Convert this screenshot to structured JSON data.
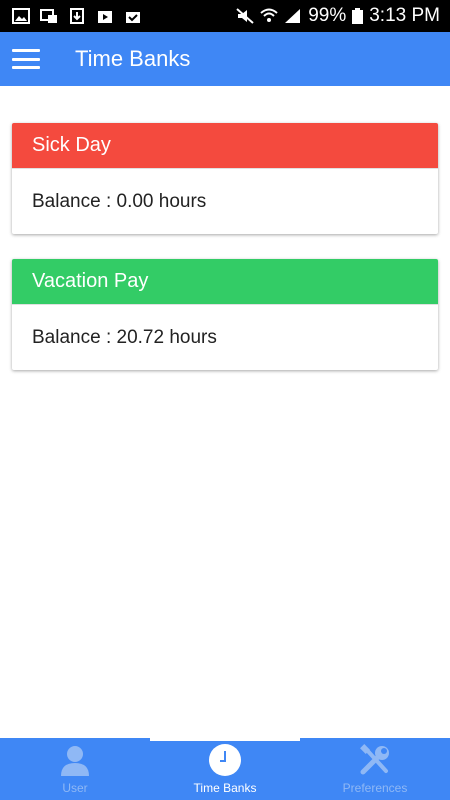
{
  "status_bar": {
    "battery": "99%",
    "time": "3:13 PM"
  },
  "app_bar": {
    "title": "Time Banks"
  },
  "time_banks": [
    {
      "name": "Sick Day",
      "balance": "Balance : 0.00 hours",
      "color": "#f44a3e"
    },
    {
      "name": "Vacation Pay",
      "balance": "Balance : 20.72 hours",
      "color": "#33cc66"
    }
  ],
  "tabs": [
    {
      "label": "User",
      "icon": "user-icon",
      "active": false
    },
    {
      "label": "Time Banks",
      "icon": "clock-icon",
      "active": true
    },
    {
      "label": "Preferences",
      "icon": "tools-icon",
      "active": false
    }
  ],
  "colors": {
    "primary": "#3f87f5",
    "tab_inactive": "#8fb8f5"
  }
}
